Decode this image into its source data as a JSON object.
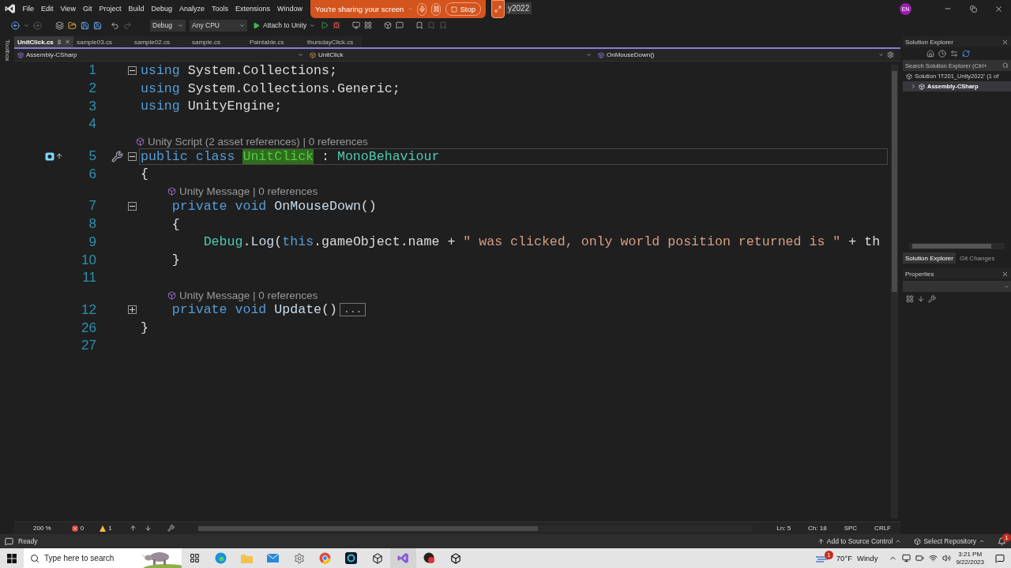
{
  "title_bar": {
    "menu": [
      "File",
      "Edit",
      "View",
      "Git",
      "Project",
      "Build",
      "Debug",
      "Analyze",
      "Tools",
      "Extensions",
      "Window"
    ],
    "title": "y2022",
    "avatar": "EN"
  },
  "sharing_banner": {
    "message": "You're sharing your screen",
    "stop": "Stop"
  },
  "toolbar": {
    "configuration": "Debug",
    "platform": "Any CPU",
    "attach": "Attach to Unity"
  },
  "toolbox": {
    "label": "Toolbox"
  },
  "tabs": [
    {
      "label": "UnitClick.cs",
      "selected": true
    },
    {
      "label": "sample03.cs",
      "selected": false
    },
    {
      "label": "sample02.cs",
      "selected": false
    },
    {
      "label": "sample.cs",
      "selected": false
    },
    {
      "label": "Paintable.cs",
      "selected": false
    },
    {
      "label": "thursdayClick.cs",
      "selected": false
    }
  ],
  "navigation_bar": {
    "project": "Assembly-CSharp",
    "type": "UnitClick",
    "member": "OnMouseDown()"
  },
  "code_lines": [
    {
      "number": "1",
      "expanded": true,
      "tokens": [
        {
          "kind": "keyword",
          "text": "using"
        },
        {
          "kind": "plain",
          "text": " System.Collections;"
        }
      ]
    },
    {
      "number": "2",
      "tokens": [
        {
          "kind": "keyword",
          "text": "using"
        },
        {
          "kind": "plain",
          "text": " System.Collections.Generic;"
        }
      ]
    },
    {
      "number": "3",
      "tokens": [
        {
          "kind": "keyword",
          "text": "using"
        },
        {
          "kind": "plain",
          "text": " UnityEngine;"
        }
      ]
    },
    {
      "number": "4"
    },
    {
      "number": "5",
      "expanded": true,
      "current": true,
      "lens": "Unity Script (2 asset references) | 0 references",
      "tokens": [
        {
          "kind": "keyword",
          "text": "public class "
        },
        {
          "kind": "highlight",
          "text": "UnitClick"
        },
        {
          "kind": "plain",
          "text": " : "
        },
        {
          "kind": "type",
          "text": "MonoBehaviour"
        }
      ]
    },
    {
      "number": "6",
      "tokens": [
        {
          "kind": "plain",
          "text": "{"
        }
      ]
    },
    {
      "number": "7",
      "expanded": true,
      "lens": "Unity Message | 0 references",
      "tokens": [
        {
          "kind": "keyword",
          "text": "    private void "
        },
        {
          "kind": "method",
          "text": "OnMouseDown"
        },
        {
          "kind": "plain",
          "text": "()"
        }
      ]
    },
    {
      "number": "8",
      "tokens": [
        {
          "kind": "plain",
          "text": "    {"
        }
      ]
    },
    {
      "number": "9",
      "tokens": [
        {
          "kind": "type",
          "text": "        Debug"
        },
        {
          "kind": "plain",
          "text": "."
        },
        {
          "kind": "method",
          "text": "Log"
        },
        {
          "kind": "plain",
          "text": "("
        },
        {
          "kind": "keyword",
          "text": "this"
        },
        {
          "kind": "plain",
          "text": ".gameObject.name + "
        },
        {
          "kind": "string",
          "text": "\" was clicked, only world position returned is \""
        },
        {
          "kind": "plain",
          "text": " + th"
        }
      ]
    },
    {
      "number": "10",
      "tokens": [
        {
          "kind": "plain",
          "text": "    }"
        }
      ]
    },
    {
      "number": "11"
    },
    {
      "number": "12",
      "expanded": false,
      "lens": "Unity Message | 0 references",
      "collapsed_text": "...",
      "tokens": [
        {
          "kind": "keyword",
          "text": "    private void "
        },
        {
          "kind": "method",
          "text": "Update"
        },
        {
          "kind": "plain",
          "text": "()"
        }
      ]
    },
    {
      "number": "26",
      "tokens": [
        {
          "kind": "plain",
          "text": "}"
        }
      ]
    },
    {
      "number": "27"
    }
  ],
  "editor_status": {
    "zoom": "200 %",
    "errors": "0",
    "warnings": "1",
    "line": "Ln: 5",
    "column": "Ch: 18",
    "whitespace": "SPC",
    "line_ending": "CRLF"
  },
  "solution_explorer": {
    "title": "Solution Explorer",
    "search_placeholder": "Search Solution Explorer (Ctrl+",
    "tree": [
      {
        "label": "Solution 'IT201_Unity2022' (1 of",
        "selected": false,
        "children": [
          {
            "label": "Assembly-CSharp",
            "expanded": false,
            "selected": true
          }
        ]
      }
    ]
  },
  "panel_tabs": [
    {
      "label": "Solution Explorer",
      "selected": true
    },
    {
      "label": "Git Changes",
      "selected": false
    }
  ],
  "properties": {
    "title": "Properties"
  },
  "status_bar": {
    "status": "Ready",
    "source_control": "Add to Source Control",
    "repository": "Select Repository",
    "notification_badge": "1"
  },
  "taskbar": {
    "search_placeholder": "Type here to search",
    "weather_badge": "1",
    "temperature": "70°F",
    "weather": "Windy",
    "time": "3:21 PM",
    "date": "9/22/2023"
  }
}
